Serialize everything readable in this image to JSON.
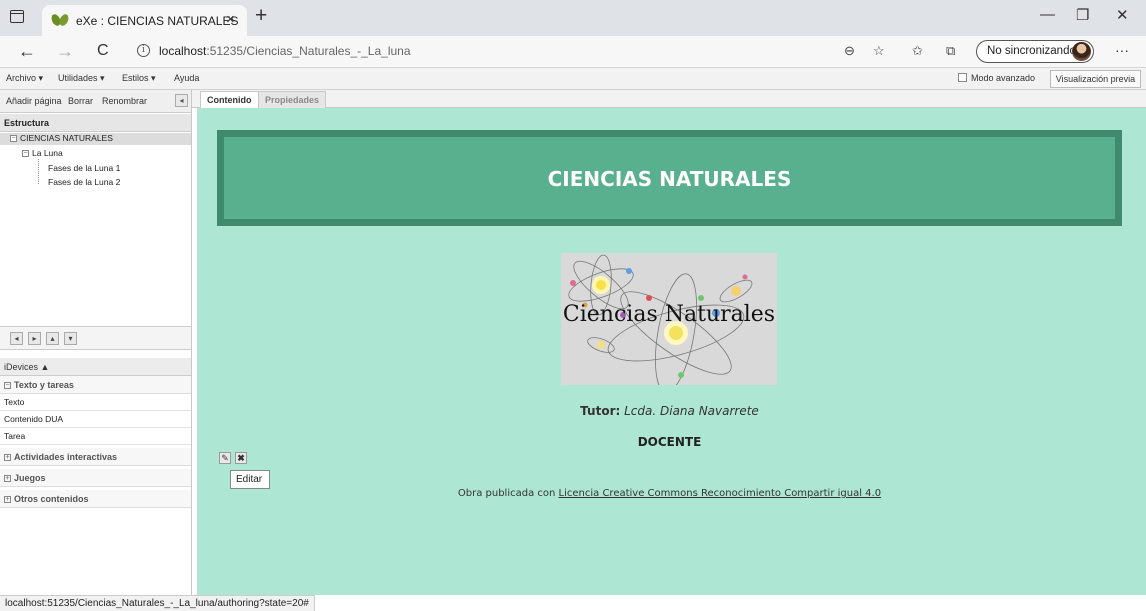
{
  "browser": {
    "tab_title": "eXe : CIENCIAS NATURALES",
    "url_host": "localhost",
    "url_path": ":51235/Ciencias_Naturales_-_La_luna",
    "sync_label": "No sincronizando",
    "new_tab": "+",
    "close": "×",
    "minimize": "—",
    "restore": "❐",
    "window_close": "✕",
    "back": "←",
    "forward": "→",
    "refresh": "C",
    "more": "···"
  },
  "menubar": {
    "items": [
      "Archivo ▾",
      "Utilidades ▾",
      "Estilos ▾",
      "Ayuda"
    ],
    "advanced_mode_label": "Modo avanzado",
    "preview_label": "Visualización previa"
  },
  "left_panel": {
    "toolbar": [
      "Añadir página",
      "Borrar",
      "Renombrar"
    ],
    "structure_heading": "Estructura",
    "tree": {
      "root": "CIENCIAS NATURALES",
      "child": "La Luna",
      "grandchildren": [
        "Fases de la Luna 1",
        "Fases de la Luna 2"
      ]
    },
    "idevices_heading": "iDevices ▲",
    "groups": {
      "texto_tareas": "Texto y tareas",
      "items": [
        "Texto",
        "Contenido DUA",
        "Tarea"
      ],
      "actividades": "Actividades interactivas",
      "juegos": "Juegos",
      "otros": "Otros contenidos"
    }
  },
  "content": {
    "tabs": [
      "Contenido",
      "Propiedades"
    ],
    "header_title": "CIENCIAS NATURALES",
    "banner_text": "Ciencias Naturales",
    "tutor_label": "Tutor:",
    "tutor_name": "Lcda. Diana Navarrete",
    "role": "DOCENTE",
    "tooltip": "Editar",
    "license_prefix": "Obra publicada con ",
    "license_link": "Licencia Creative Commons Reconocimiento Compartir igual 4.0"
  },
  "status_url": "localhost:51235/Ciencias_Naturales_-_La_luna/authoring?state=20#",
  "colors": {
    "canvas_bg": "#aee6d4",
    "header_bg": "#58b08f",
    "header_border": "#3f8a6c"
  }
}
